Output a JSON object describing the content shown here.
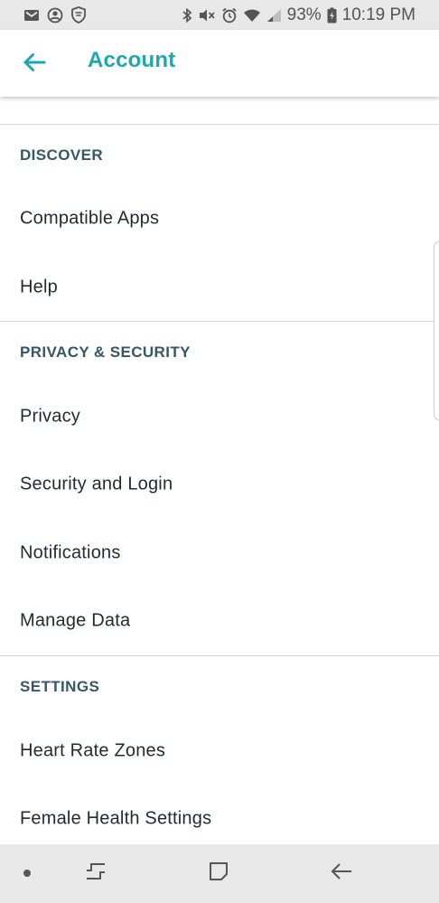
{
  "status_bar": {
    "left_icons": [
      "mail-icon",
      "account-circle-icon",
      "shield-icon"
    ],
    "right_icons": [
      "bluetooth-icon",
      "vibrate-mute-icon",
      "alarm-icon",
      "wifi-icon",
      "signal-icon",
      "battery-charging-icon"
    ],
    "battery_percent": "93%",
    "time": "10:19 PM"
  },
  "app_bar": {
    "back_icon": "arrow-left-icon",
    "title": "Account"
  },
  "colors": {
    "accent": "#1fa7b0",
    "section_header": "#355766",
    "text": "#1f2a33",
    "divider": "#d8d8d8",
    "system_bar": "#e8e8e8"
  },
  "content": {
    "sections": [
      {
        "header": "DISCOVER",
        "items": [
          {
            "label": "Compatible Apps"
          },
          {
            "label": "Help"
          }
        ]
      },
      {
        "header": "PRIVACY & SECURITY",
        "items": [
          {
            "label": "Privacy"
          },
          {
            "label": "Security and Login"
          },
          {
            "label": "Notifications"
          },
          {
            "label": "Manage Data"
          }
        ]
      },
      {
        "header": "SETTINGS",
        "items": [
          {
            "label": "Heart Rate Zones"
          },
          {
            "label": "Female Health Settings"
          }
        ]
      }
    ]
  },
  "nav_bar": {
    "buttons": [
      "dot-icon",
      "recent-apps-icon",
      "home-icon",
      "back-icon"
    ]
  }
}
